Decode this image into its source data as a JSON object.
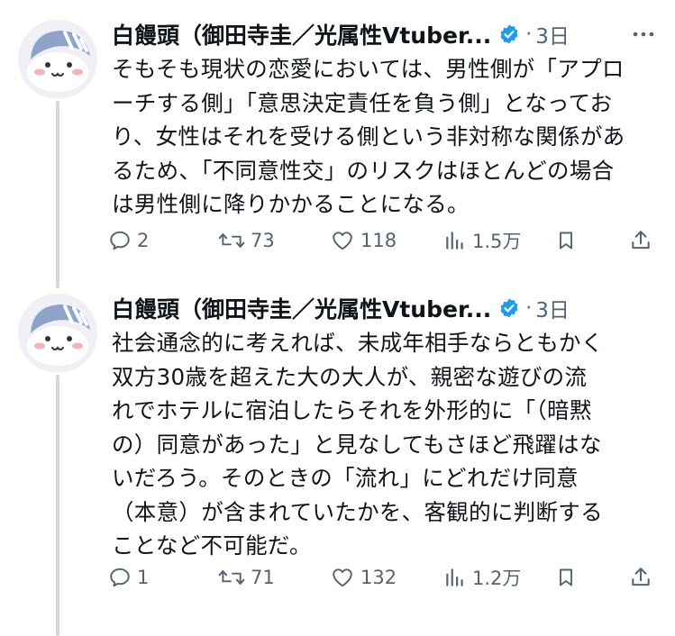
{
  "tweets": [
    {
      "author_name": "白饅頭（御田寺圭／光属性Vtuber...",
      "dot": "·",
      "time": "3日",
      "lines": [
        "そもそも現状の恋愛においては、男性側が「アプロ",
        "ーチする側」「意思決定責任を負う側」となってお",
        "り、女性はそれを受ける側という非対称な関係があ",
        "るため、「不同意性交」のリスクはほとんどの場合",
        "は男性側に降りかかることになる。"
      ],
      "replies": "2",
      "reposts": "73",
      "likes": "118",
      "views": "1.5万"
    },
    {
      "author_name": "白饅頭（御田寺圭／光属性Vtuber...",
      "dot": "·",
      "time": "3日",
      "lines": [
        "社会通念的に考えれば、未成年相手ならともかく",
        "双方30歳を超えた大の大人が、親密な遊びの流",
        "れでホテルに宿泊したらそれを外形的に「（暗黙",
        "の）同意があった」と見なしてもさほど飛躍はな",
        "いだろう。そのときの「流れ」にどれだけ同意",
        "（本意）が含まれていたかを、客観的に判断する",
        "ことなど不可能だ。"
      ],
      "replies": "1",
      "reposts": "71",
      "likes": "132",
      "views": "1.2万"
    }
  ],
  "colors": {
    "text": "#0f1419",
    "secondary": "#536471",
    "verified": "#1d9bf0",
    "thread_line": "#cfd9de"
  },
  "icons": [
    "avatar",
    "verified-badge-icon",
    "more-icon",
    "reply-icon",
    "repost-icon",
    "like-icon",
    "views-icon",
    "bookmark-icon",
    "share-icon"
  ]
}
